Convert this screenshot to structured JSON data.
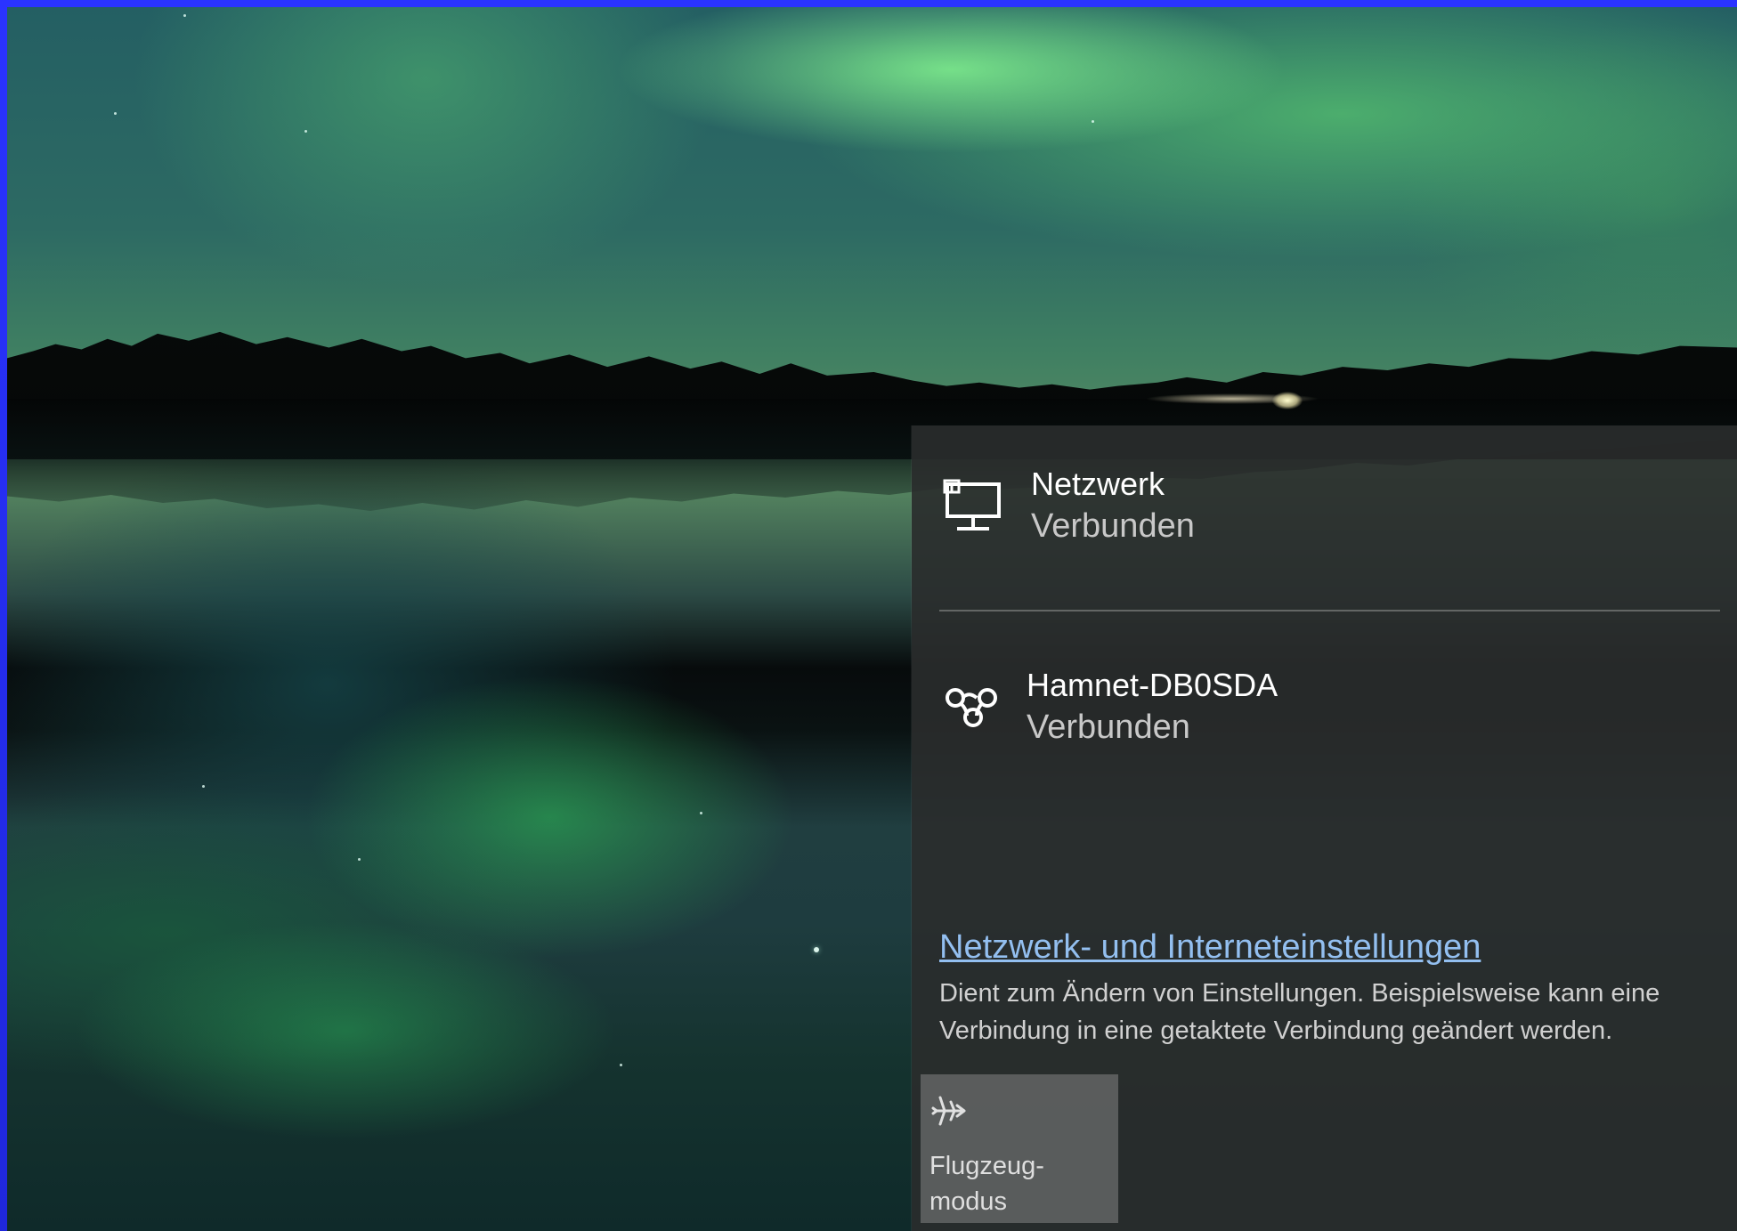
{
  "connections": [
    {
      "icon": "ethernet-computer-icon",
      "title": "Netzwerk",
      "status": "Verbunden"
    },
    {
      "icon": "vpn-link-icon",
      "title": "Hamnet-DB0SDA",
      "status": "Verbunden"
    }
  ],
  "settings": {
    "link": "Netzwerk- und Interneteinstellungen",
    "description": "Dient zum Ändern von Einstellungen. Beispielsweise kann eine Verbindung in eine getaktete Verbindung geändert werden."
  },
  "quick_actions": [
    {
      "icon": "airplane-icon",
      "label": "Flugzeug-\nmodus"
    }
  ]
}
